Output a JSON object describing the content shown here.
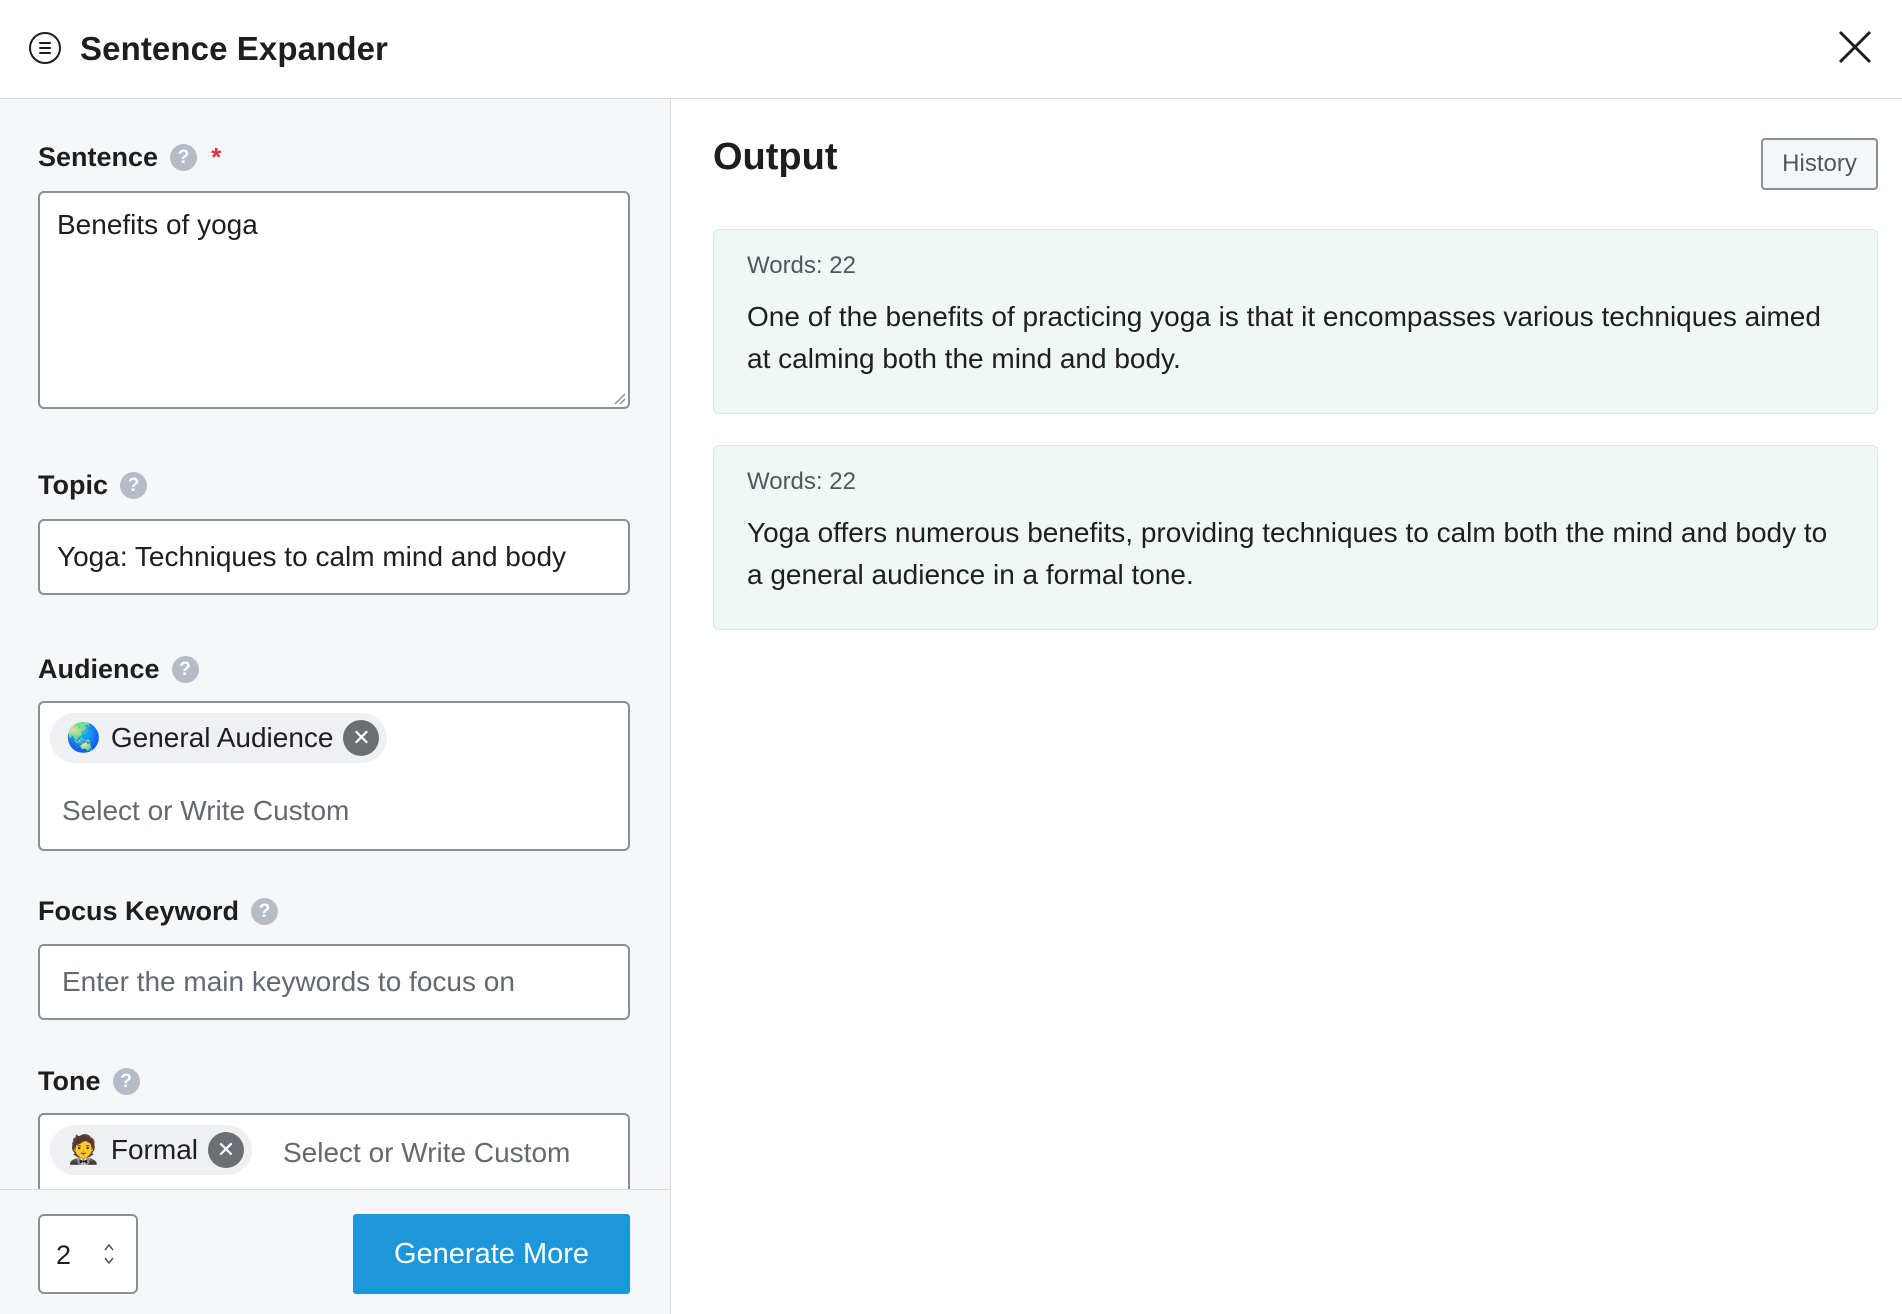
{
  "header": {
    "title": "Sentence Expander"
  },
  "form": {
    "sentence": {
      "label": "Sentence",
      "help": "?",
      "required_mark": "*",
      "value": "Benefits of yoga"
    },
    "topic": {
      "label": "Topic",
      "help": "?",
      "value": "Yoga: Techniques to calm mind and body"
    },
    "audience": {
      "label": "Audience",
      "help": "?",
      "chip": {
        "emoji": "🌏",
        "label": "General Audience"
      },
      "placeholder": "Select or Write Custom"
    },
    "focus_keyword": {
      "label": "Focus Keyword",
      "help": "?",
      "placeholder": "Enter the main keywords to focus on"
    },
    "tone": {
      "label": "Tone",
      "help": "?",
      "chip": {
        "emoji": "🤵",
        "label": "Formal"
      },
      "placeholder": "Select or Write Custom"
    }
  },
  "footer": {
    "quantity": "2",
    "generate_label": "Generate More"
  },
  "output": {
    "title": "Output",
    "history_label": "History",
    "results": [
      {
        "words": "Words: 22",
        "text": "One of the benefits of practicing yoga is that it encompasses various techniques aimed at calming both the mind and body."
      },
      {
        "words": "Words: 22",
        "text": "Yoga offers numerous benefits, providing techniques to calm both the mind and body to a general audience in a formal tone."
      }
    ]
  },
  "colors": {
    "accent": "#1d97d9",
    "card_bg": "#eff8f5",
    "required": "#d63638"
  },
  "icons": {
    "menu": "menu-circle-icon",
    "close": "close-icon",
    "help": "question-circle-icon",
    "chip_remove": "remove-circle-icon",
    "spinner": "up-down-chevron-icon"
  }
}
